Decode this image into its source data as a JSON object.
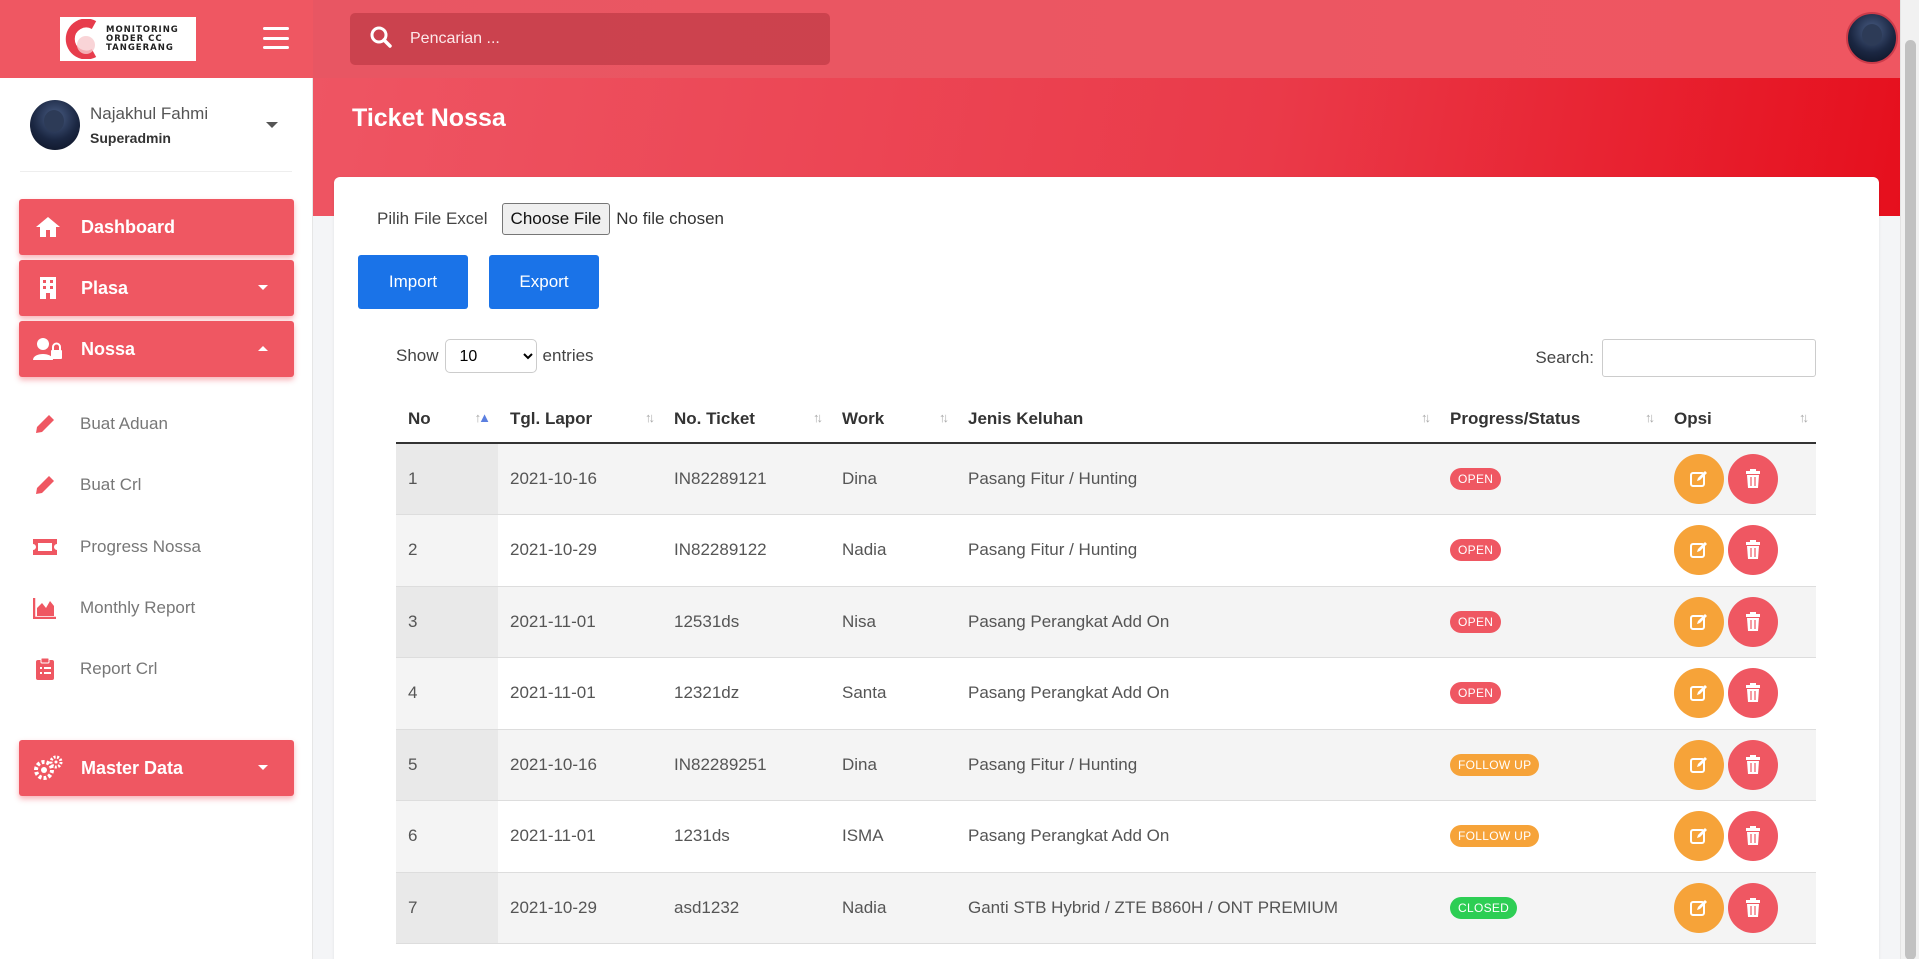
{
  "app": {
    "logo_text": [
      "MONITORING",
      "ORDER CC",
      "TANGERANG"
    ],
    "search_placeholder": "Pencarian ..."
  },
  "user": {
    "name": "Najakhul Fahmi",
    "role": "Superadmin"
  },
  "sidebar": {
    "menus": [
      {
        "label": "Dashboard",
        "icon": "home-icon",
        "has_caret": false
      },
      {
        "label": "Plasa",
        "icon": "building-icon",
        "has_caret": true,
        "expanded": false
      },
      {
        "label": "Nossa",
        "icon": "user-lock-icon",
        "has_caret": true,
        "expanded": true
      }
    ],
    "nossa_items": [
      {
        "label": "Buat Aduan",
        "icon": "pencil-icon"
      },
      {
        "label": "Buat Crl",
        "icon": "pencil-icon"
      },
      {
        "label": "Progress Nossa",
        "icon": "ticket-icon"
      },
      {
        "label": "Monthly Report",
        "icon": "area-chart-icon"
      },
      {
        "label": "Report Crl",
        "icon": "clipboard-icon"
      }
    ],
    "master": {
      "label": "Master Data",
      "icon": "cogs-icon"
    }
  },
  "page": {
    "title": "Ticket Nossa",
    "file_label": "Pilih File Excel",
    "file_button": "Choose File",
    "file_status": "No file chosen",
    "import_label": "Import",
    "export_label": "Export",
    "show_label": "Show",
    "entries_label": "entries",
    "entries_value": "10",
    "search_label": "Search:"
  },
  "table": {
    "columns": [
      "No",
      "Tgl. Lapor",
      "No. Ticket",
      "Work",
      "Jenis Keluhan",
      "Progress/Status",
      "Opsi"
    ],
    "rows": [
      {
        "no": "1",
        "tgl": "2021-10-16",
        "ticket": "IN82289121",
        "work": "Dina",
        "keluhan": "Pasang Fitur / Hunting",
        "status": "OPEN"
      },
      {
        "no": "2",
        "tgl": "2021-10-29",
        "ticket": "IN82289122",
        "work": "Nadia",
        "keluhan": "Pasang Fitur / Hunting",
        "status": "OPEN"
      },
      {
        "no": "3",
        "tgl": "2021-11-01",
        "ticket": "12531ds",
        "work": "Nisa",
        "keluhan": "Pasang Perangkat Add On",
        "status": "OPEN"
      },
      {
        "no": "4",
        "tgl": "2021-11-01",
        "ticket": "12321dz",
        "work": "Santa",
        "keluhan": "Pasang Perangkat Add On",
        "status": "OPEN"
      },
      {
        "no": "5",
        "tgl": "2021-10-16",
        "ticket": "IN82289251",
        "work": "Dina",
        "keluhan": "Pasang Fitur / Hunting",
        "status": "FOLLOW UP"
      },
      {
        "no": "6",
        "tgl": "2021-11-01",
        "ticket": "1231ds",
        "work": "ISMA",
        "keluhan": "Pasang Perangkat Add On",
        "status": "FOLLOW UP"
      },
      {
        "no": "7",
        "tgl": "2021-10-29",
        "ticket": "asd1232",
        "work": "Nadia",
        "keluhan": "Ganti STB Hybrid / ZTE B860H / ONT PREMIUM",
        "status": "CLOSED"
      }
    ]
  },
  "colors": {
    "primary": "#ef5762",
    "blue": "#1a73e8",
    "open": "#ef5762",
    "follow_up": "#f6a339",
    "closed": "#2dce54",
    "edit": "#f6a339",
    "delete": "#ef5762"
  }
}
